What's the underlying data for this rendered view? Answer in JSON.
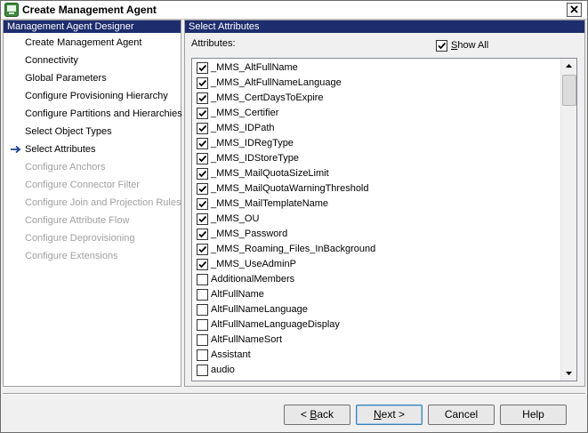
{
  "window": {
    "title": "Create Management Agent"
  },
  "left_pane": {
    "header": "Management Agent Designer",
    "current_index": 6,
    "items": [
      {
        "label": "Create Management Agent",
        "enabled": true
      },
      {
        "label": "Connectivity",
        "enabled": true
      },
      {
        "label": "Global Parameters",
        "enabled": true
      },
      {
        "label": "Configure Provisioning Hierarchy",
        "enabled": true
      },
      {
        "label": "Configure Partitions and Hierarchies",
        "enabled": true
      },
      {
        "label": "Select Object Types",
        "enabled": true
      },
      {
        "label": "Select Attributes",
        "enabled": true
      },
      {
        "label": "Configure Anchors",
        "enabled": false
      },
      {
        "label": "Configure Connector Filter",
        "enabled": false
      },
      {
        "label": "Configure Join and Projection Rules",
        "enabled": false
      },
      {
        "label": "Configure Attribute Flow",
        "enabled": false
      },
      {
        "label": "Configure Deprovisioning",
        "enabled": false
      },
      {
        "label": "Configure Extensions",
        "enabled": false
      }
    ]
  },
  "right_pane": {
    "header": "Select Attributes",
    "attributes_label": "Attributes:",
    "show_all": {
      "label": "Show All",
      "checked": true
    },
    "attributes": [
      {
        "name": "_MMS_AltFullName",
        "checked": true
      },
      {
        "name": "_MMS_AltFullNameLanguage",
        "checked": true
      },
      {
        "name": "_MMS_CertDaysToExpire",
        "checked": true
      },
      {
        "name": "_MMS_Certifier",
        "checked": true
      },
      {
        "name": "_MMS_IDPath",
        "checked": true
      },
      {
        "name": "_MMS_IDRegType",
        "checked": true
      },
      {
        "name": "_MMS_IDStoreType",
        "checked": true
      },
      {
        "name": "_MMS_MailQuotaSizeLimit",
        "checked": true
      },
      {
        "name": "_MMS_MailQuotaWarningThreshold",
        "checked": true
      },
      {
        "name": "_MMS_MailTemplateName",
        "checked": true
      },
      {
        "name": "_MMS_OU",
        "checked": true
      },
      {
        "name": "_MMS_Password",
        "checked": true
      },
      {
        "name": "_MMS_Roaming_Files_InBackground",
        "checked": true
      },
      {
        "name": "_MMS_UseAdminP",
        "checked": true
      },
      {
        "name": "AdditionalMembers",
        "checked": false
      },
      {
        "name": "AltFullName",
        "checked": false
      },
      {
        "name": "AltFullNameLanguage",
        "checked": false
      },
      {
        "name": "AltFullNameLanguageDisplay",
        "checked": false
      },
      {
        "name": "AltFullNameSort",
        "checked": false
      },
      {
        "name": "Assistant",
        "checked": false
      },
      {
        "name": "audio",
        "checked": false
      }
    ]
  },
  "buttons": {
    "back": {
      "prefix": "< ",
      "accel": "B",
      "rest": "ack"
    },
    "next": {
      "accel": "N",
      "rest": "ext",
      "suffix": " >"
    },
    "cancel": "Cancel",
    "help": "Help"
  },
  "colors": {
    "header_bg": "#1d2d6d",
    "disabled_text": "#a0a0a0",
    "arrow": "#1a3f9c"
  }
}
